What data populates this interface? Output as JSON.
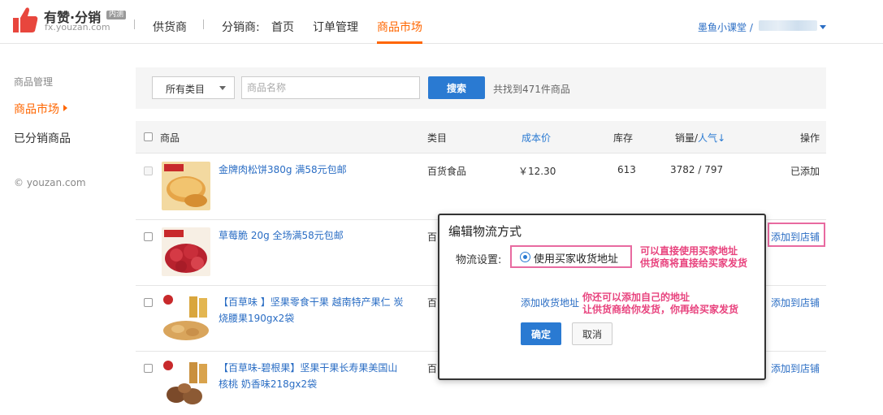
{
  "header": {
    "logo_title": "有赞·分销",
    "logo_badge": "内测",
    "logo_sub": "fx.youzan.com",
    "nav": {
      "supplier": "供货商",
      "distributor_label": "分销商:",
      "home": "首页",
      "orders": "订单管理",
      "market": "商品市场"
    },
    "user": "墨鱼小课堂 /"
  },
  "sidebar": {
    "section_title": "商品管理",
    "items": [
      {
        "label": "商品市场",
        "active": true
      },
      {
        "label": "已分销商品",
        "active": false
      }
    ],
    "copyright": "© youzan.com"
  },
  "filter": {
    "category": "所有类目",
    "search_placeholder": "商品名称",
    "search_button": "搜索",
    "result_count": "共找到471件商品"
  },
  "table": {
    "headers": {
      "product": "商品",
      "category": "类目",
      "cost": "成本价",
      "stock": "库存",
      "sales_prefix": "销量/",
      "sales_link": "人气",
      "sales_arrow": "↓",
      "action": "操作"
    },
    "rows": [
      {
        "title": "金牌肉松饼380g 满58元包邮",
        "category": "百货食品",
        "price": "￥12.30",
        "stock": "613",
        "sales": "3782 / 797",
        "action": "已添加"
      },
      {
        "title": "草莓脆 20g 全场满58元包邮",
        "category": "百",
        "action": "添加到店铺"
      },
      {
        "title": "【百草味 】坚果零食干果 越南特产果仁 炭烧腰果190gx2袋",
        "category": "百",
        "action": "添加到店铺"
      },
      {
        "title": "【百草味-碧根果】坚果干果长寿果美国山核桃 奶香味218gx2袋",
        "category": "百",
        "action": "添加到店铺"
      }
    ]
  },
  "popup": {
    "title": "编辑物流方式",
    "label": "物流设置:",
    "radio_option": "使用买家收货地址",
    "add_address": "添加收货地址",
    "ok": "确定",
    "cancel": "取消",
    "annotation1_line1": "可以直接使用买家地址",
    "annotation1_line2": "供货商将直接给买家发货",
    "annotation2_line1": "你还可以添加自己的地址",
    "annotation2_line2": "让供货商给你发货，你再给买家发货"
  },
  "colors": {
    "accent": "#ff6600",
    "link": "#2a6dc4",
    "primary_button": "#2a7ad2",
    "annotation": "#e8437e"
  }
}
